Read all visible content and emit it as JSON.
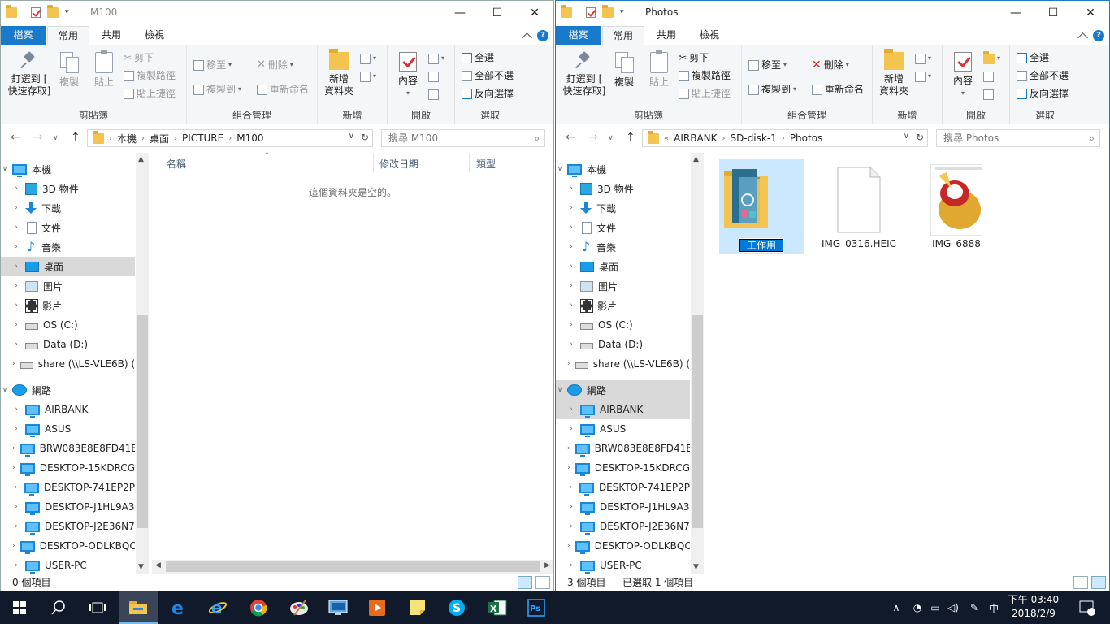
{
  "left_window": {
    "title": "M100",
    "tabs": {
      "file": "檔案",
      "home": "常用",
      "share": "共用",
      "view": "檢視"
    },
    "ribbon": {
      "pin": "釘選到 [\n快速存取]",
      "copy": "複製",
      "paste": "貼上",
      "cut": "剪下",
      "copy_path": "複製路徑",
      "paste_shortcut": "貼上捷徑",
      "clipboard_group": "剪貼簿",
      "move_to": "移至",
      "copy_to": "複製到",
      "delete": "刪除",
      "rename": "重新命名",
      "organize_group": "組合管理",
      "new_folder": "新增\n資料夾",
      "new_group": "新增",
      "properties": "內容",
      "open_group": "開啟",
      "select_all": "全選",
      "select_none": "全部不選",
      "invert": "反向選擇",
      "select_group": "選取"
    },
    "breadcrumb": [
      "本機",
      "桌面",
      "PICTURE",
      "M100"
    ],
    "search_placeholder": "搜尋 M100",
    "columns": {
      "name": "名稱",
      "modified": "修改日期",
      "type": "類型"
    },
    "empty_message": "這個資料夾是空的。",
    "status": "0 個項目"
  },
  "right_window": {
    "title": "Photos",
    "tabs": {
      "file": "檔案",
      "home": "常用",
      "share": "共用",
      "view": "檢視"
    },
    "ribbon": {
      "pin": "釘選到 [\n快速存取]",
      "copy": "複製",
      "paste": "貼上",
      "cut": "剪下",
      "copy_path": "複製路徑",
      "paste_shortcut": "貼上捷徑",
      "clipboard_group": "剪貼簿",
      "move_to": "移至",
      "copy_to": "複製到",
      "delete": "刪除",
      "rename": "重新命名",
      "organize_group": "組合管理",
      "new_folder": "新增\n資料夾",
      "new_group": "新增",
      "properties": "內容",
      "open_group": "開啟",
      "select_all": "全選",
      "select_none": "全部不選",
      "invert": "反向選擇",
      "select_group": "選取"
    },
    "breadcrumb_prefix": "«",
    "breadcrumb": [
      "AIRBANK",
      "SD-disk-1",
      "Photos"
    ],
    "search_placeholder": "搜尋 Photos",
    "files": [
      {
        "name": "工作用",
        "kind": "folder",
        "selected": true,
        "renaming": true
      },
      {
        "name": "IMG_0316.HEIC",
        "kind": "blank-file"
      },
      {
        "name": "IMG_6888",
        "kind": "image"
      }
    ],
    "status_count": "3 個項目",
    "status_selected": "已選取 1 個項目"
  },
  "nav_tree": {
    "this_pc": "本機",
    "this_pc_items": [
      "3D 物件",
      "下載",
      "文件",
      "音樂",
      "桌面",
      "圖片",
      "影片",
      "OS (C:)",
      "Data (D:)",
      "share (\\\\LS-VLE6B) ("
    ],
    "network": "網路",
    "network_items": [
      "AIRBANK",
      "ASUS",
      "BRW083E8E8FD41E",
      "DESKTOP-15KDRCG",
      "DESKTOP-741EP2P",
      "DESKTOP-J1HL9A3",
      "DESKTOP-J2E36N7",
      "DESKTOP-ODLKBQC",
      "USER-PC"
    ]
  },
  "taskbar": {
    "clock_period": "下午 03:40",
    "clock_date": "2018/2/9",
    "ime": "中",
    "notification_count": "3",
    "apps": [
      "start-icon",
      "search-icon",
      "task-view-icon",
      "file-explorer-icon",
      "edge-icon",
      "ie-icon",
      "chrome-icon",
      "paint-icon",
      "remote-icon",
      "media-icon",
      "sticky-notes-icon",
      "skype-icon",
      "excel-icon",
      "photoshop-icon"
    ]
  },
  "colors": {
    "accent": "#1979ca",
    "taskbar": "#101a2a",
    "selection": "#cce8ff"
  }
}
